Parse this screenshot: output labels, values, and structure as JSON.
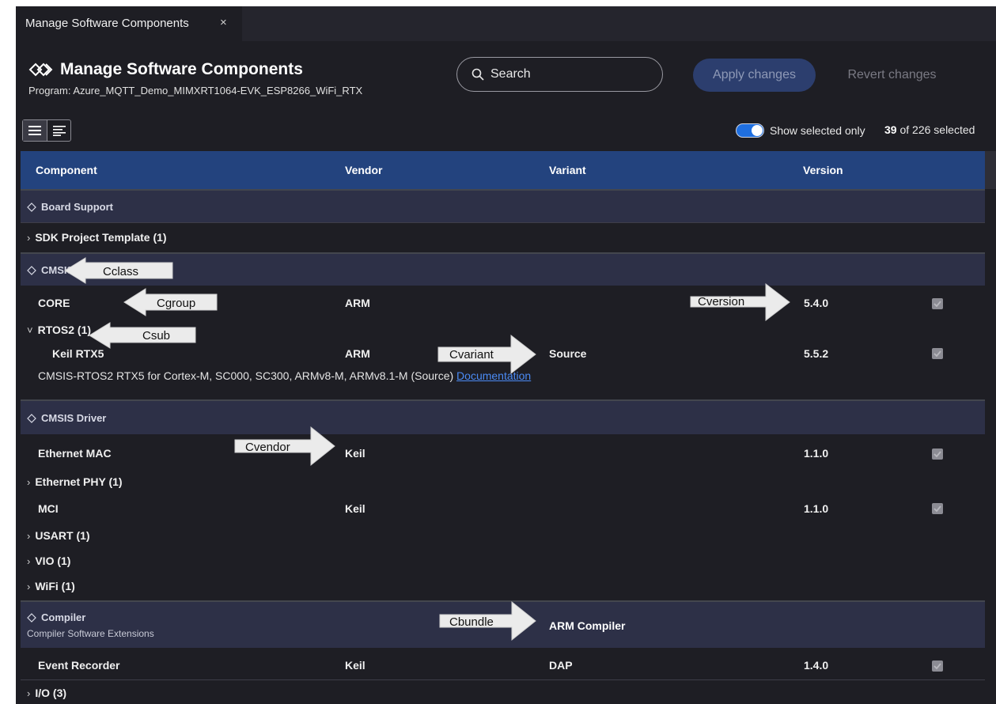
{
  "tab": {
    "title": "Manage Software Components",
    "close": "×"
  },
  "header": {
    "title": "Manage Software Components",
    "program": "Program: Azure_MQTT_Demo_MIMXRT1064-EVK_ESP8266_WiFi_RTX"
  },
  "search": {
    "placeholder": "Search"
  },
  "buttons": {
    "apply": "Apply changes",
    "revert": "Revert changes"
  },
  "filter": {
    "show_selected_label": "Show selected only",
    "show_selected_on": true,
    "selected_count": "39",
    "selected_suffix": "of 226 selected"
  },
  "columns": {
    "component": "Component",
    "vendor": "Vendor",
    "variant": "Variant",
    "version": "Version"
  },
  "rows": {
    "board_support": "Board Support",
    "sdk_template": "SDK Project Template (1)",
    "cmsis": "CMSIS",
    "core": {
      "name": "CORE",
      "vendor": "ARM",
      "version": "5.4.0",
      "checked": true
    },
    "rtos2": "RTOS2 (1)",
    "keil_rtx5": {
      "name": "Keil RTX5",
      "vendor": "ARM",
      "variant": "Source",
      "version": "5.5.2",
      "checked": true
    },
    "rtx5_desc": "CMSIS-RTOS2 RTX5 for Cortex-M, SC000, SC300, ARMv8-M, ARMv8.1-M (Source)",
    "doc_link": "Documentation",
    "cmsis_driver": "CMSIS Driver",
    "ethernet_mac": {
      "name": "Ethernet MAC",
      "vendor": "Keil",
      "version": "1.1.0",
      "checked": true
    },
    "ethernet_phy": "Ethernet PHY (1)",
    "mci": {
      "name": "MCI",
      "vendor": "Keil",
      "version": "1.1.0",
      "checked": true
    },
    "usart": "USART (1)",
    "vio": "VIO (1)",
    "wifi": "WiFi (1)",
    "compiler": "Compiler",
    "compiler_desc": "Compiler Software Extensions",
    "compiler_bundle": "ARM Compiler",
    "event_recorder": {
      "name": "Event Recorder",
      "vendor": "Keil",
      "variant": "DAP",
      "version": "1.4.0",
      "checked": true
    },
    "io": "I/O (3)"
  },
  "callouts": {
    "cclass": "Cclass",
    "cgroup": "Cgroup",
    "csub": "Csub",
    "cversion": "Cversion",
    "cvariant": "Cvariant",
    "cvendor": "Cvendor",
    "cbundle": "Cbundle"
  },
  "colors": {
    "accent": "#1f6fe0",
    "table_header": "#23437e",
    "class_row": "#2d3047",
    "background": "#1e1e24"
  }
}
